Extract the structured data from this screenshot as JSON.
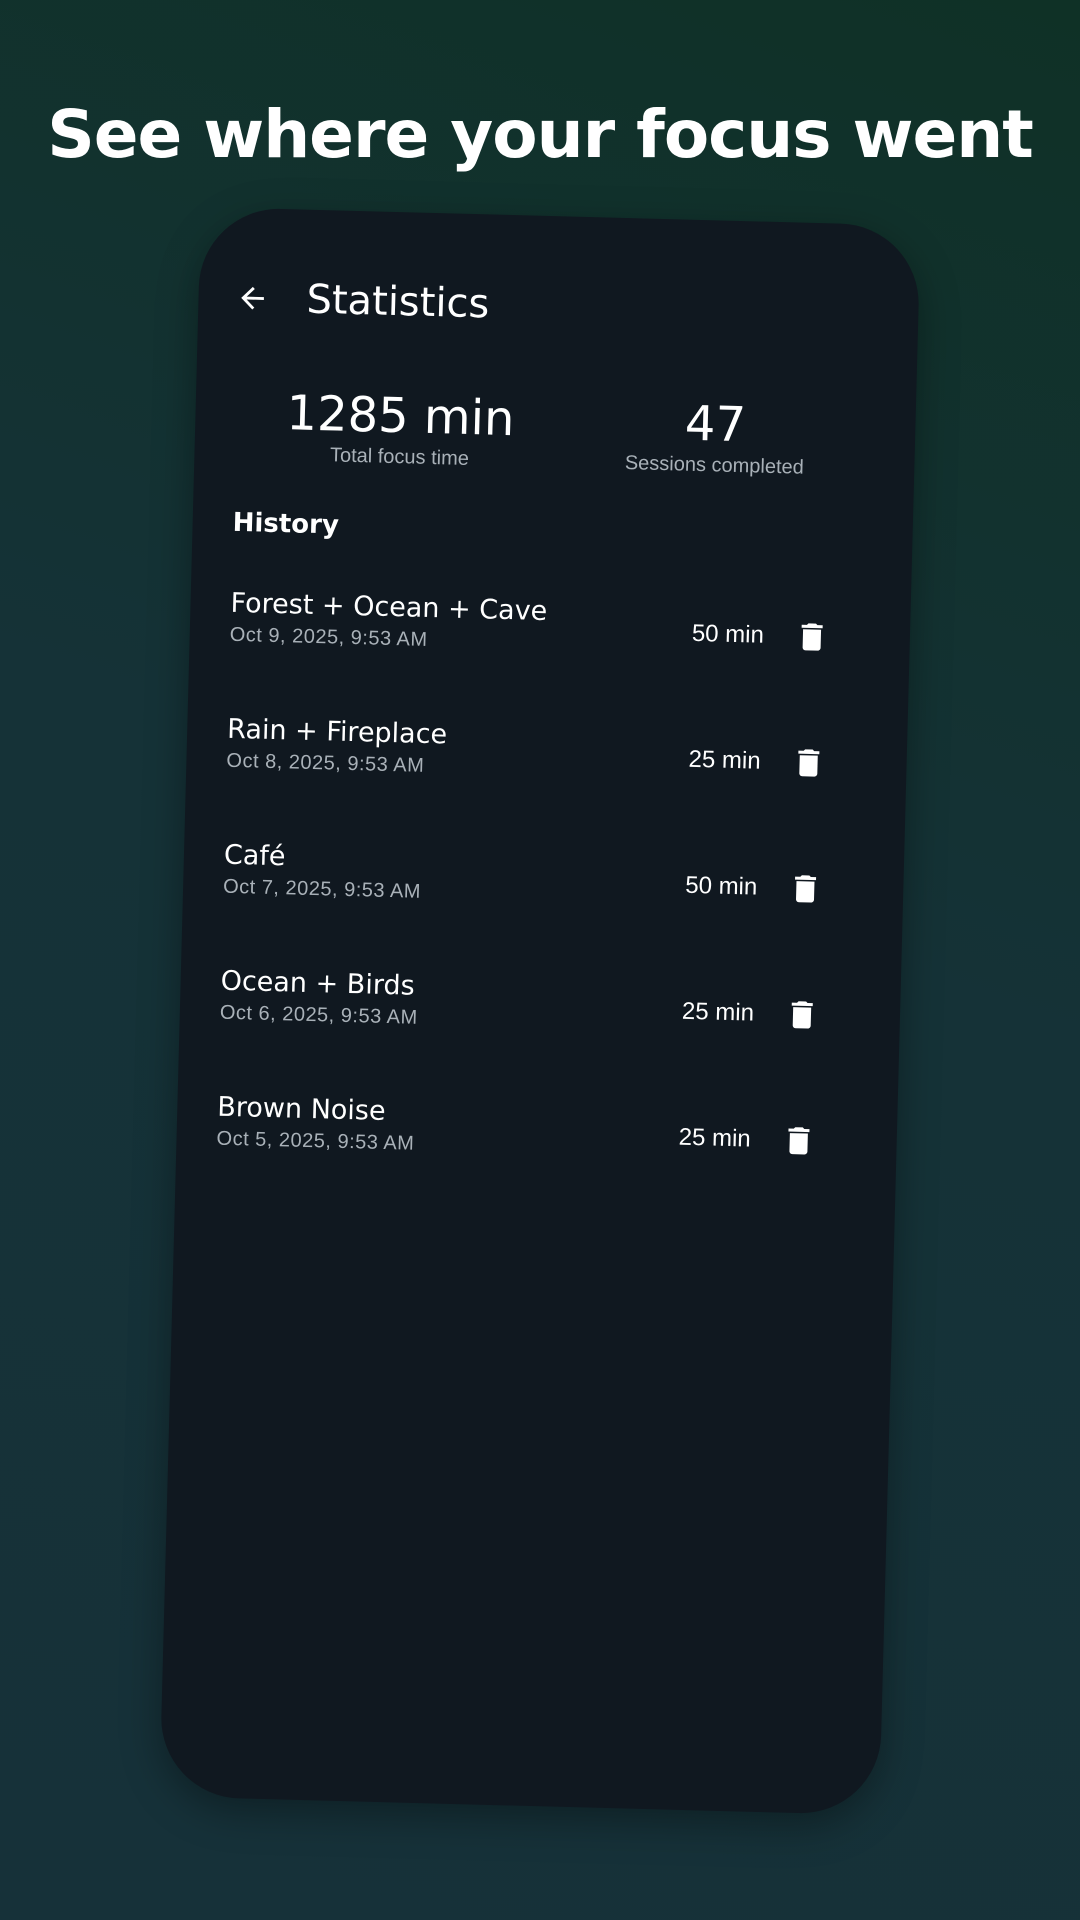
{
  "headline": "See where your focus went",
  "appbar": {
    "title": "Statistics",
    "back_icon": "arrow-left-icon"
  },
  "stats": {
    "total_focus_value": "1285 min",
    "total_focus_label": "Total focus time",
    "sessions_value": "47",
    "sessions_label": "Sessions completed"
  },
  "history": {
    "title": "History",
    "items": [
      {
        "name": "Forest + Ocean + Cave",
        "date": "Oct 9, 2025, 9:53 AM",
        "duration": "50 min"
      },
      {
        "name": "Rain + Fireplace",
        "date": "Oct 8, 2025, 9:53 AM",
        "duration": "25 min"
      },
      {
        "name": "Café",
        "date": "Oct 7, 2025, 9:53 AM",
        "duration": "50 min"
      },
      {
        "name": "Ocean + Birds",
        "date": "Oct 6, 2025, 9:53 AM",
        "duration": "25 min"
      },
      {
        "name": "Brown Noise",
        "date": "Oct 5, 2025, 9:53 AM",
        "duration": "25 min"
      }
    ],
    "delete_icon": "trash-icon"
  },
  "colors": {
    "background_top": "#0f3126",
    "background_bottom": "#163139",
    "card": "#101820",
    "secondary_text": "#a9b1b8"
  }
}
